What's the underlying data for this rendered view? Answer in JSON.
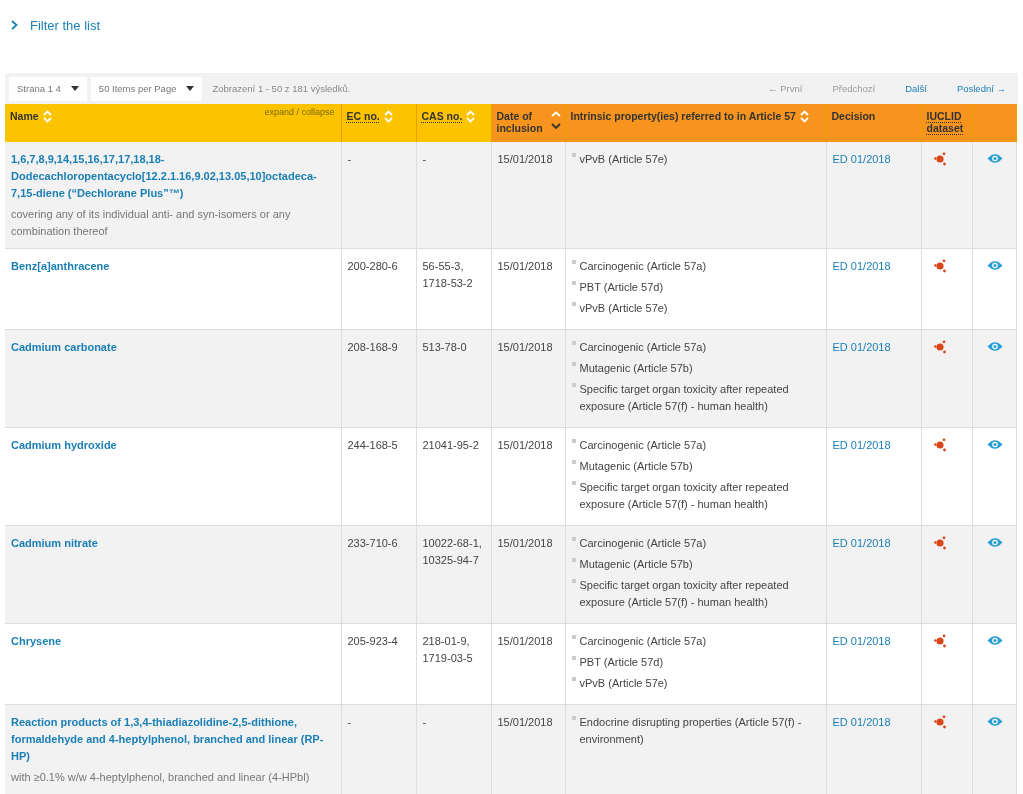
{
  "filter": {
    "label": "Filter the list",
    "expanded": false
  },
  "toolbar": {
    "page_select": "Strana 1  4",
    "per_page_select": "50 Items per Page",
    "summary": "Zobrazení 1 - 50 z 181 výsledků.",
    "pager": [
      {
        "label": "← První",
        "disabled": true
      },
      {
        "label": "Předchozí",
        "disabled": true
      },
      {
        "label": "Další",
        "disabled": false
      },
      {
        "label": "Poslední →",
        "disabled": false
      }
    ]
  },
  "table": {
    "expand_collapse": "expand / collapse",
    "columns": [
      {
        "label": "Name",
        "color": "#fcc400",
        "sortable": true,
        "sorted_desc": false,
        "underlined": false
      },
      {
        "label": "EC no.",
        "color": "#fcc400",
        "sortable": true,
        "sorted_desc": false,
        "underlined": true
      },
      {
        "label": "CAS no.",
        "color": "#fcc400",
        "sortable": true,
        "sorted_desc": false,
        "underlined": true
      },
      {
        "label": "Date of inclusion",
        "color": "#f7941d",
        "sortable": true,
        "sorted_desc": true,
        "underlined": false
      },
      {
        "label": "Intrinsic property(ies) referred to in Article 57",
        "color": "#f7941d",
        "sortable": true,
        "sorted_desc": false,
        "underlined": false
      },
      {
        "label": "Decision",
        "color": "#f7941d",
        "sortable": false,
        "sorted_desc": false,
        "underlined": false
      },
      {
        "label": "IUCLID dataset",
        "color": "#f7941d",
        "sortable": false,
        "sorted_desc": false,
        "underlined": true
      }
    ],
    "rows": [
      {
        "name": "1,6,7,8,9,14,15,16,17,17,18,18-Dodecachloropentacyclo[12.2.1.16,9.02,13.05,10]octadeca-7,15-diene (“Dechlorane Plus”™)",
        "note": "covering any of its individual anti- and syn-isomers or any combination thereof",
        "ec": "-",
        "cas": "-",
        "date": "15/01/2018",
        "properties": [
          "vPvB (Article 57e)"
        ],
        "decision": "ED 01/2018"
      },
      {
        "name": "Benz[a]anthracene",
        "ec": "200-280-6",
        "cas": "56-55-3, 1718-53-2",
        "date": "15/01/2018",
        "properties": [
          "Carcinogenic (Article 57a)",
          "PBT (Article 57d)",
          "vPvB (Article 57e)"
        ],
        "decision": "ED 01/2018"
      },
      {
        "name": "Cadmium carbonate",
        "ec": "208-168-9",
        "cas": "513-78-0",
        "date": "15/01/2018",
        "properties": [
          "Carcinogenic (Article 57a)",
          "Mutagenic (Article 57b)",
          "Specific target organ toxicity after repeated exposure (Article 57(f) - human health)"
        ],
        "decision": "ED 01/2018"
      },
      {
        "name": "Cadmium hydroxide",
        "ec": "244-168-5",
        "cas": "21041-95-2",
        "date": "15/01/2018",
        "properties": [
          "Carcinogenic (Article 57a)",
          "Mutagenic (Article 57b)",
          "Specific target organ toxicity after repeated exposure (Article 57(f) - human health)"
        ],
        "decision": "ED 01/2018"
      },
      {
        "name": "Cadmium nitrate",
        "ec": "233-710-6",
        "cas": "10022-68-1, 10325-94-7",
        "date": "15/01/2018",
        "properties": [
          "Carcinogenic (Article 57a)",
          "Mutagenic (Article 57b)",
          "Specific target organ toxicity after repeated exposure (Article 57(f) - human health)"
        ],
        "decision": "ED 01/2018"
      },
      {
        "name": "Chrysene",
        "ec": "205-923-4",
        "cas": "218-01-9, 1719-03-5",
        "date": "15/01/2018",
        "properties": [
          "Carcinogenic (Article 57a)",
          "PBT (Article 57d)",
          "vPvB (Article 57e)"
        ],
        "decision": "ED 01/2018"
      },
      {
        "name": "Reaction products of 1,3,4-thiadiazolidine-2,5-dithione, formaldehyde and 4-heptylphenol, branched and linear (RP-HP)",
        "note": "with ≥0.1% w/w 4-heptylphenol, branched and linear (4-HPbl)",
        "ec": "-",
        "cas": "-",
        "date": "15/01/2018",
        "properties": [
          "Endocrine disrupting properties (Article 57(f) - environment)"
        ],
        "decision": "ED 01/2018"
      }
    ]
  }
}
